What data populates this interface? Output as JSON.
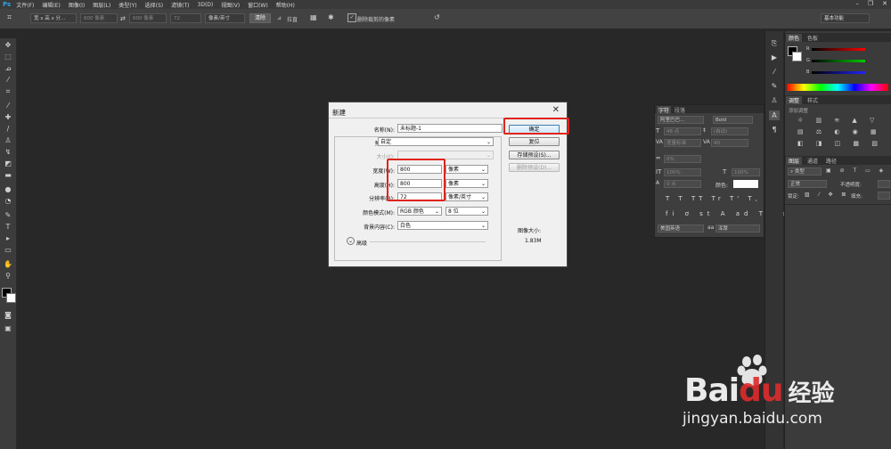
{
  "app": {
    "logo": "Ps"
  },
  "menu": [
    "文件(F)",
    "编辑(E)",
    "图像(I)",
    "图层(L)",
    "类型(Y)",
    "选择(S)",
    "滤镜(T)",
    "3D(D)",
    "视图(V)",
    "窗口(W)",
    "帮助(H)"
  ],
  "window_buttons": [
    "–",
    "❐",
    "✕"
  ],
  "options_bar": {
    "preset": "宽 x 高 x 分...",
    "width_placeholder": "600 像素",
    "height_placeholder": "600 像素",
    "resolution": "72",
    "unit": "像素/英寸",
    "clear_button": "清除",
    "straighten_label": "拉直",
    "delete_cropped_label": "删除裁剪的像素",
    "workspace": "基本功能"
  },
  "dialog": {
    "title": "新建",
    "name_label": "名称(N):",
    "name_value": "未标题-1",
    "preset_label": "预设(P):",
    "preset_value": "自定",
    "size_label": "大小(I):",
    "width_label": "宽度(W):",
    "width_value": "800",
    "width_unit": "像素",
    "height_label": "高度(H):",
    "height_value": "800",
    "height_unit": "像素",
    "resolution_label": "分辨率(R):",
    "resolution_value": "72",
    "resolution_unit": "像素/英寸",
    "color_mode_label": "颜色模式(M):",
    "color_mode_value": "RGB 颜色",
    "bit_depth_value": "8 位",
    "background_label": "背景内容(C):",
    "background_value": "白色",
    "advanced_label": "高级",
    "ok_button": "确定",
    "reset_button": "复位",
    "save_preset_button": "存储预设(S)...",
    "delete_preset_button": "删除预设(D)...",
    "image_size_label": "图像大小:",
    "image_size_value": "1.83M"
  },
  "character_panel": {
    "tabs": [
      "字符",
      "段落"
    ],
    "font_family": "阿里巴巴...",
    "font_style": "Bold",
    "size": "48 点",
    "leading": "(自动)",
    "kerning": "度量标准",
    "tracking": "40",
    "scale_v": "100%",
    "scale_h": "100%",
    "baseline": "0 点",
    "color_label": "颜色:",
    "language": "美国英语",
    "antialias": "浑厚",
    "tracking_pct": "0%"
  },
  "color_panel": {
    "tabs": [
      "颜色",
      "色板"
    ],
    "channels": [
      "R",
      "G",
      "B"
    ]
  },
  "adjust_panel": {
    "tabs": [
      "调整",
      "样式"
    ],
    "subtitle": "添加调整"
  },
  "layers_panel": {
    "tabs": [
      "图层",
      "通道",
      "路径"
    ],
    "kind": "类型",
    "blend": "正常",
    "opacity_label": "不透明度:",
    "lock_label": "锁定:",
    "fill_label": "填充:"
  },
  "watermark": {
    "brand": "Bai",
    "brand2": "du",
    "jingyan": "经验",
    "url": "jingyan.baidu.com"
  },
  "colors": {
    "accent_red": "#e0231c",
    "ps_blue": "#2fa3e6",
    "baidu_red": "#de2c2c"
  }
}
